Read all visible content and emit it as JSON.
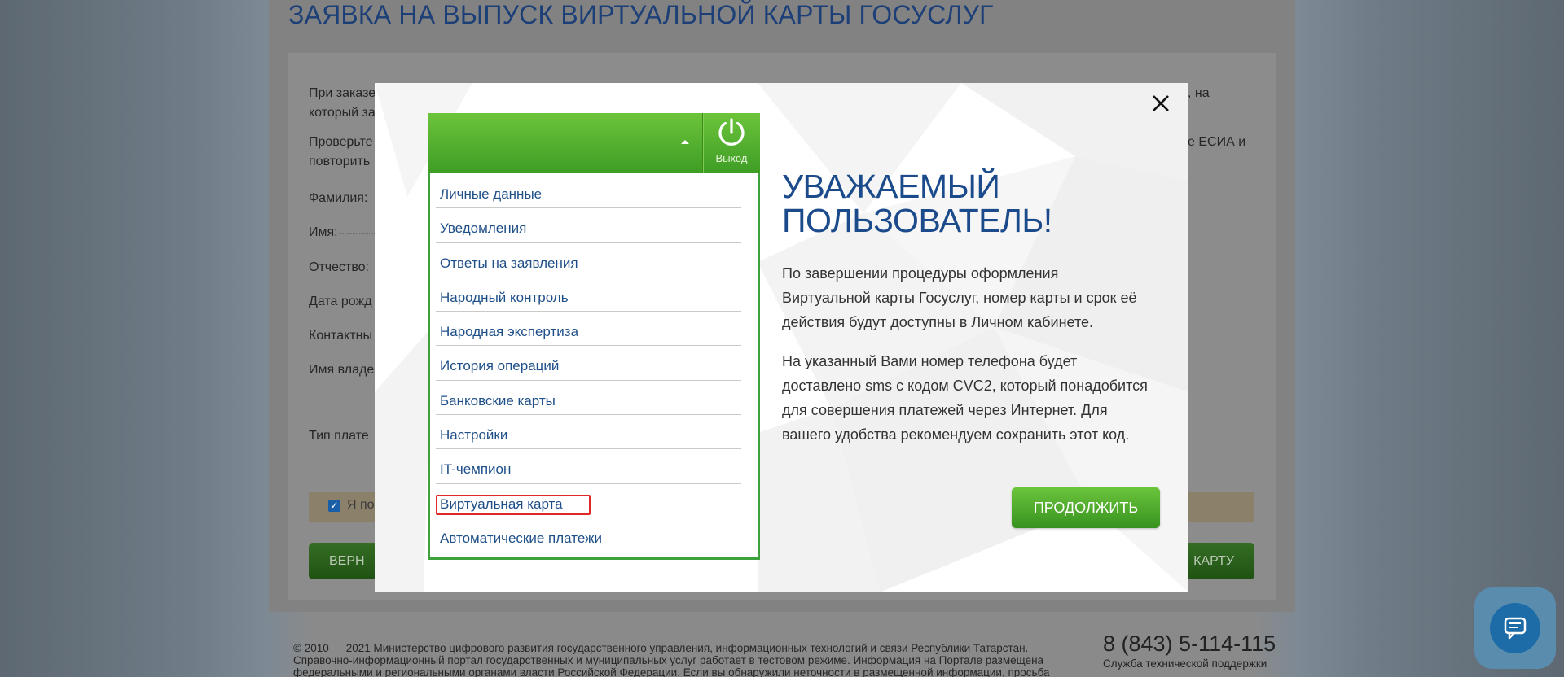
{
  "page": {
    "title": "ЗАЯВКА НА ВЫПУСК ВИРТУАЛЬНОЙ КАРТЫ ГОСУСЛУГ",
    "intro_line1_left": "При заказе",
    "intro_line1_right": ", на",
    "intro_line2_left": "который за",
    "check_line1_left": "Проверьте",
    "check_line1_right": "е ЕСИА и",
    "check_line2_left": "повторить",
    "fields": [
      "Фамилия:",
      "Имя:",
      "Отчество:",
      "Дата рожд",
      "Контактны",
      "Имя владел"
    ],
    "payment_type_label": "Тип плате",
    "agree_text": "Я по",
    "back_button": "ВЕРН",
    "issue_button": "КАРТУ"
  },
  "footer": {
    "copyright": "© 2010 — 2021 Министерство цифрового развития государственного управления, информационных технологий и связи Республики Татарстан.",
    "test_mode": "Справочно-информационный портал государственных и муниципальных услуг работает в тестовом режиме. Информация на Портале размещена",
    "notice": "федеральными и региональными органами власти Российской Федерации. Если вы обнаружили неточности в размещенной информации, просьба",
    "phone": "8 (843) 5-114-115",
    "support": "Служба технической поддержки"
  },
  "modal": {
    "menu": {
      "exit_label": "Выход",
      "items": [
        "Личные данные",
        "Уведомления",
        "Ответы на заявления",
        "Народный контроль",
        "Народная экспертиза",
        "История операций",
        "Банковские карты",
        "Настройки",
        "IT-чемпион",
        "Виртуальная карта",
        "Автоматические платежи"
      ],
      "highlighted_index": 9
    },
    "heading": "Уважаемый пользователь!",
    "paragraph1": "По завершении процедуры оформления Виртуальной карты Госуслуг, номер карты и срок её действия будут доступны в Личном кабинете.",
    "paragraph2": "На указанный Вами номер телефона будет доставлено sms с кодом CVC2, который понадобится для совершения платежей через Интернет. Для вашего удобства рекомендуем сохранить этот код.",
    "continue_button": "Продолжить",
    "close_icon": "close-icon"
  },
  "colors": {
    "accent_green": "#4caf30",
    "heading_blue": "#1c4b8c",
    "highlight_red": "#e02828"
  }
}
